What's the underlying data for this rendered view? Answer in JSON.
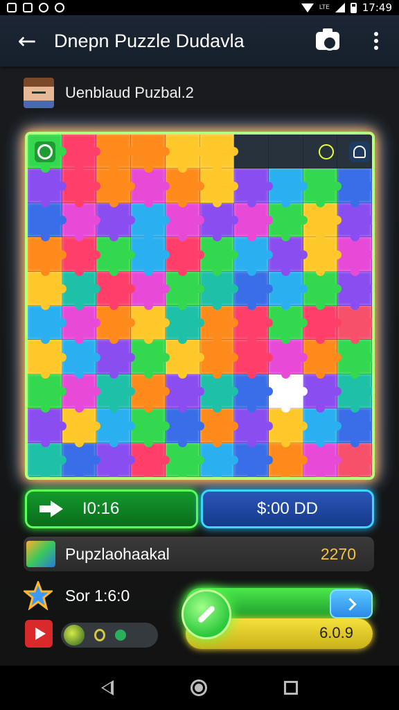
{
  "status_bar": {
    "time": "17:49",
    "network": "LTE"
  },
  "app_bar": {
    "title": "Dnepn Puzzle Dudavla"
  },
  "subheader": {
    "title": "Uenblaud Puzbal.2"
  },
  "board": {
    "palette": [
      "#ff3e6a",
      "#ff8a1c",
      "#ffc82a",
      "#34d84e",
      "#1ec0a8",
      "#2ab0f0",
      "#3a6ee8",
      "#8a4ef0",
      "#e84ad8",
      "#f6506a"
    ],
    "cells": [
      [
        3,
        0,
        1,
        1,
        2,
        2,
        -1,
        -1,
        -1,
        -1
      ],
      [
        7,
        0,
        1,
        8,
        1,
        2,
        7,
        5,
        3,
        6
      ],
      [
        6,
        8,
        7,
        5,
        8,
        7,
        8,
        3,
        2,
        7
      ],
      [
        1,
        0,
        3,
        5,
        0,
        3,
        5,
        7,
        2,
        8
      ],
      [
        2,
        4,
        0,
        8,
        3,
        4,
        6,
        5,
        3,
        7
      ],
      [
        5,
        8,
        1,
        2,
        4,
        1,
        0,
        3,
        0,
        9
      ],
      [
        2,
        5,
        7,
        3,
        2,
        1,
        0,
        8,
        1,
        3
      ],
      [
        3,
        8,
        4,
        1,
        7,
        4,
        6,
        -2,
        7,
        4
      ],
      [
        7,
        2,
        5,
        3,
        6,
        1,
        7,
        2,
        5,
        6
      ],
      [
        4,
        6,
        7,
        0,
        3,
        5,
        6,
        1,
        8,
        9
      ]
    ]
  },
  "stats": {
    "time": "I0:16",
    "money": "$:00 DD"
  },
  "score_row": {
    "label": "Pupzlaohaakal",
    "value": "2270"
  },
  "controls": {
    "sor_label": "Sor 1:6:0",
    "slider_value": "6.0.9"
  },
  "colors": {
    "time_accent": "#5cff5c",
    "money_accent": "#3ad8ff",
    "score_value": "#f6c33c"
  },
  "icons": [
    "back-arrow-icon",
    "camera-icon",
    "more-vert-icon",
    "avatar",
    "hint-icon",
    "timer-icon",
    "user-icon",
    "arrow-right-icon",
    "star-icon",
    "play-icon",
    "chevron-right-icon",
    "pen-icon"
  ]
}
